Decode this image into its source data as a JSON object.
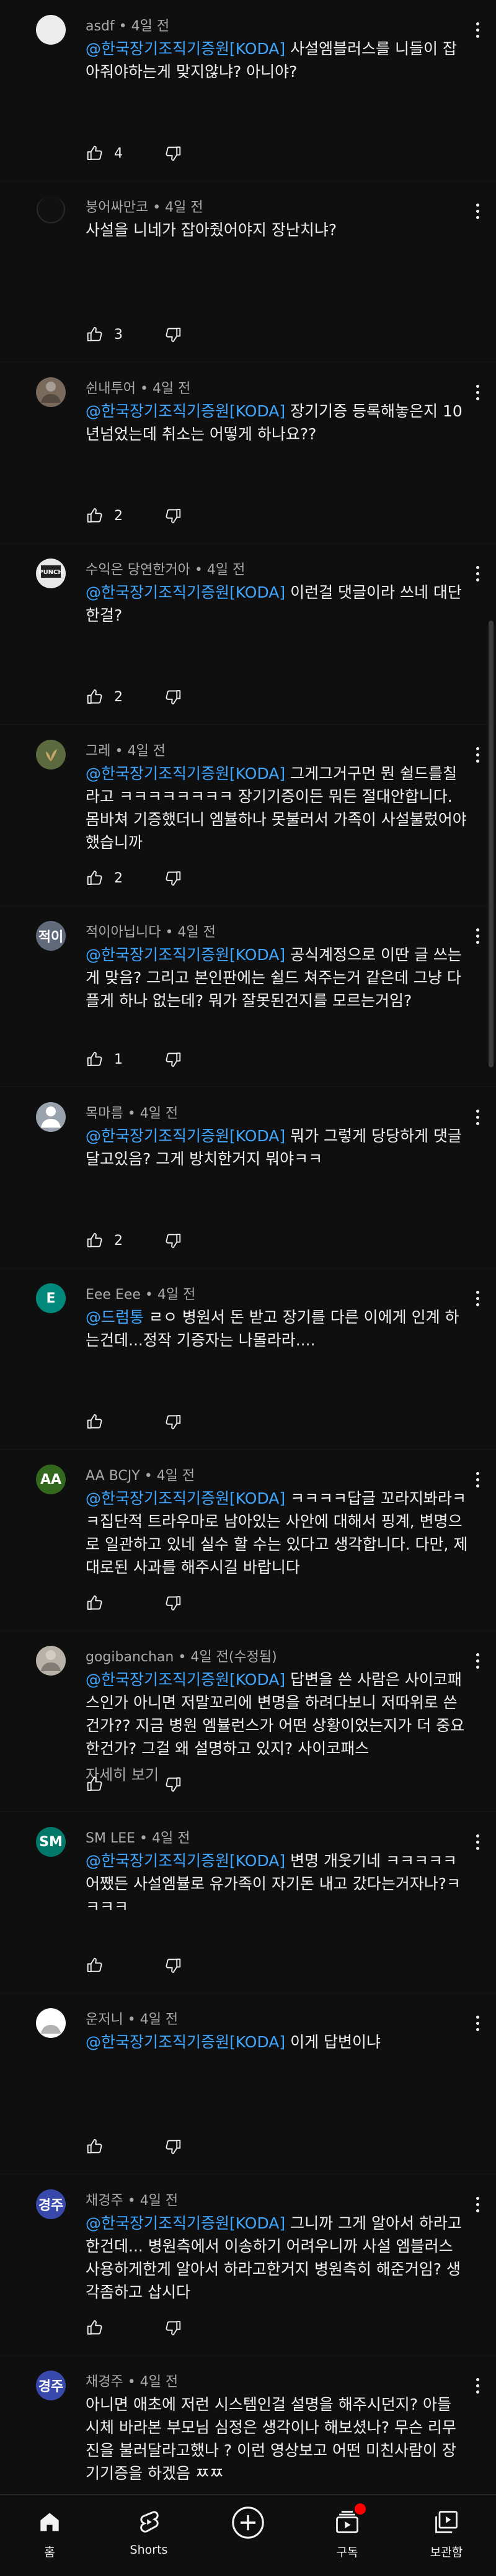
{
  "colors": {
    "background": "#0f0f0f",
    "text": "#f1f1f1",
    "meta": "#aaaaaa",
    "mention": "#3ea6ff",
    "notification": "#ff0000"
  },
  "comments": [
    {
      "author": "asdf",
      "time": "4일 전",
      "edited": "",
      "mention": "@한국장기조직기증원[KODA]",
      "text": " 사설엠블러스를 니들이 잡아줘야하는게 맞지않냐? 아니야?",
      "more": "",
      "likes": "4",
      "avatar": {
        "initial": "",
        "color": "#ececec",
        "icon": "white-circle-avatar"
      }
    },
    {
      "author": "붕어싸만코",
      "time": "4일 전",
      "edited": "",
      "mention": "",
      "text": "사설을 니네가 잡아줬어야지 장난치냐?",
      "more": "",
      "likes": "3",
      "avatar": {
        "initial": "",
        "color": "#0f0f0f",
        "icon": "dark-avatar"
      }
    },
    {
      "author": "쉰내투어",
      "time": "4일 전",
      "edited": "",
      "mention": "@한국장기조직기증원[KODA]",
      "text": " 장기기증 등록해놓은지 10년넘었는데 취소는 어떻게 하나요??",
      "more": "",
      "likes": "2",
      "avatar": {
        "initial": "",
        "color": "#7a6a5c",
        "icon": "photo-avatar"
      }
    },
    {
      "author": "수익은 당연한거아",
      "time": "4일 전",
      "edited": "",
      "mention": "@한국장기조직기증원[KODA]",
      "text": " 이런걸 댓글이라 쓰네 대단한걸?",
      "more": "",
      "likes": "2",
      "avatar": {
        "initial": "",
        "color": "#e8e8e8",
        "icon": "logo-avatar"
      }
    },
    {
      "author": "그레",
      "time": "4일 전",
      "edited": "",
      "mention": "@한국장기조직기증원[KODA]",
      "text": " 그게그거구먼 뭔 쉴드를칠라고 ㅋㅋㅋㅋㅋㅋㅋㅋ 장기기증이든 뭐든 절대안합니다. 몸바쳐 기증했더니 엠뷸하나 못불러서 가족이 사설불렀어야 했습니까",
      "more": "",
      "likes": "2",
      "avatar": {
        "initial": "",
        "color": "#5b6b3f",
        "icon": "plant-avatar"
      }
    },
    {
      "author": "적이아닙니다",
      "time": "4일 전",
      "edited": "",
      "mention": "@한국장기조직기증원[KODA]",
      "text": " 공식계정으로 이딴 글 쓰는게 맞음? 그리고 본인판에는 쉴드 쳐주는거 같은데 그냥 다플게 하나 없는데? 뭐가 잘못된건지를 모르는거임?",
      "more": "",
      "likes": "1",
      "avatar": {
        "initial": "적이",
        "color": "#606a7a",
        "icon": ""
      }
    },
    {
      "author": "목마름",
      "time": "4일 전",
      "edited": "",
      "mention": "@한국장기조직기증원[KODA]",
      "text": " 뭐가 그렇게 당당하게 댓글달고있음? 그게 방치한거지 뭐야ㅋㅋ",
      "more": "",
      "likes": "2",
      "avatar": {
        "initial": "",
        "color": "#9aa3ad",
        "icon": "person-avatar"
      }
    },
    {
      "author": "Eee Eee",
      "time": "4일 전",
      "edited": "",
      "mention": "@드럼통",
      "text": " ㄹㅇ 병원서 돈 받고 장기를 다른 이에게 인계 하는건데...정작 기증자는 나몰라라....",
      "more": "",
      "likes": "",
      "avatar": {
        "initial": "E",
        "color": "#00897b",
        "icon": ""
      }
    },
    {
      "author": "AA BCJY",
      "time": "4일 전",
      "edited": "",
      "mention": "@한국장기조직기증원[KODA]",
      "text": " ㅋㅋㅋㅋ답글 꼬라지봐라ㅋㅋ집단적 트라우마로 남아있는 사안에 대해서 핑계, 변명으로 일관하고 있네 실수 할 수는 있다고 생각합니다. 다만, 제대로된 사과를 해주시길 바랍니다",
      "more": "",
      "likes": "",
      "avatar": {
        "initial": "AA",
        "color": "#33691e",
        "icon": ""
      }
    },
    {
      "author": "gogibanchan",
      "time": "4일 전",
      "edited": "(수정됨)",
      "mention": "@한국장기조직기증원[KODA]",
      "text": " 답변을 쓴 사람은 사이코패스인가 아니면 저말꼬리에 변명을 하려다보니 저따위로 쓴건가?? 지금 병원 엠뷸런스가 어떤 상황이었는지가 더 중요한건가? 그걸 왜 설명하고 있지? 사이코패스",
      "more": "자세히 보기",
      "likes": "",
      "avatar": {
        "initial": "",
        "color": "#b9b2a8",
        "icon": "photo-avatar"
      }
    },
    {
      "author": "SM LEE",
      "time": "4일 전",
      "edited": "",
      "mention": "@한국장기조직기증원[KODA]",
      "text": " 변명 개웃기네 ㅋㅋㅋㅋㅋ 어쨌든 사설엠뷸로 유가족이 자기돈 내고 갔다는거자나?ㅋㅋㅋㅋ",
      "more": "",
      "likes": "",
      "avatar": {
        "initial": "SM",
        "color": "#00796b",
        "icon": ""
      }
    },
    {
      "author": "운저니",
      "time": "4일 전",
      "edited": "",
      "mention": "@한국장기조직기증원[KODA]",
      "text": " 이게 답변이냐",
      "more": "",
      "likes": "",
      "avatar": {
        "initial": "",
        "color": "#ffffff",
        "icon": "photo-avatar"
      }
    },
    {
      "author": "채경주",
      "time": "4일 전",
      "edited": "",
      "mention": "@한국장기조직기증원[KODA]",
      "text": " 그니까 그게 알아서 하라고한건데... 병원측에서 이송하기 어려우니까 사설 엠블러스 사용하게한게 알아서 하라고한거지 병원측히 해준거임? 생각좀하고 삽시다",
      "more": "",
      "likes": "",
      "avatar": {
        "initial": "경주",
        "color": "#3949ab",
        "icon": ""
      }
    },
    {
      "author": "채경주",
      "time": "4일 전",
      "edited": "",
      "mention": "",
      "text": "아니면 애초에 저런 시스템인걸 설명을 해주시던지? 아들 시체 바라본 부모님 심정은 생각이나 해보셨나? 무슨 리무진을 불러달라고했나 ? 이런 영상보고 어떤 미친사람이 장기기증을 하겠음 ㅉㅉ",
      "more": "",
      "likes": "",
      "avatar": {
        "initial": "경주",
        "color": "#3949ab",
        "icon": ""
      }
    }
  ],
  "nav": [
    {
      "label": "홈",
      "icon": "home-icon"
    },
    {
      "label": "Shorts",
      "icon": "shorts-icon"
    },
    {
      "label": "",
      "icon": "create-icon"
    },
    {
      "label": "구독",
      "icon": "subscriptions-icon"
    },
    {
      "label": "보관함",
      "icon": "library-icon"
    }
  ]
}
